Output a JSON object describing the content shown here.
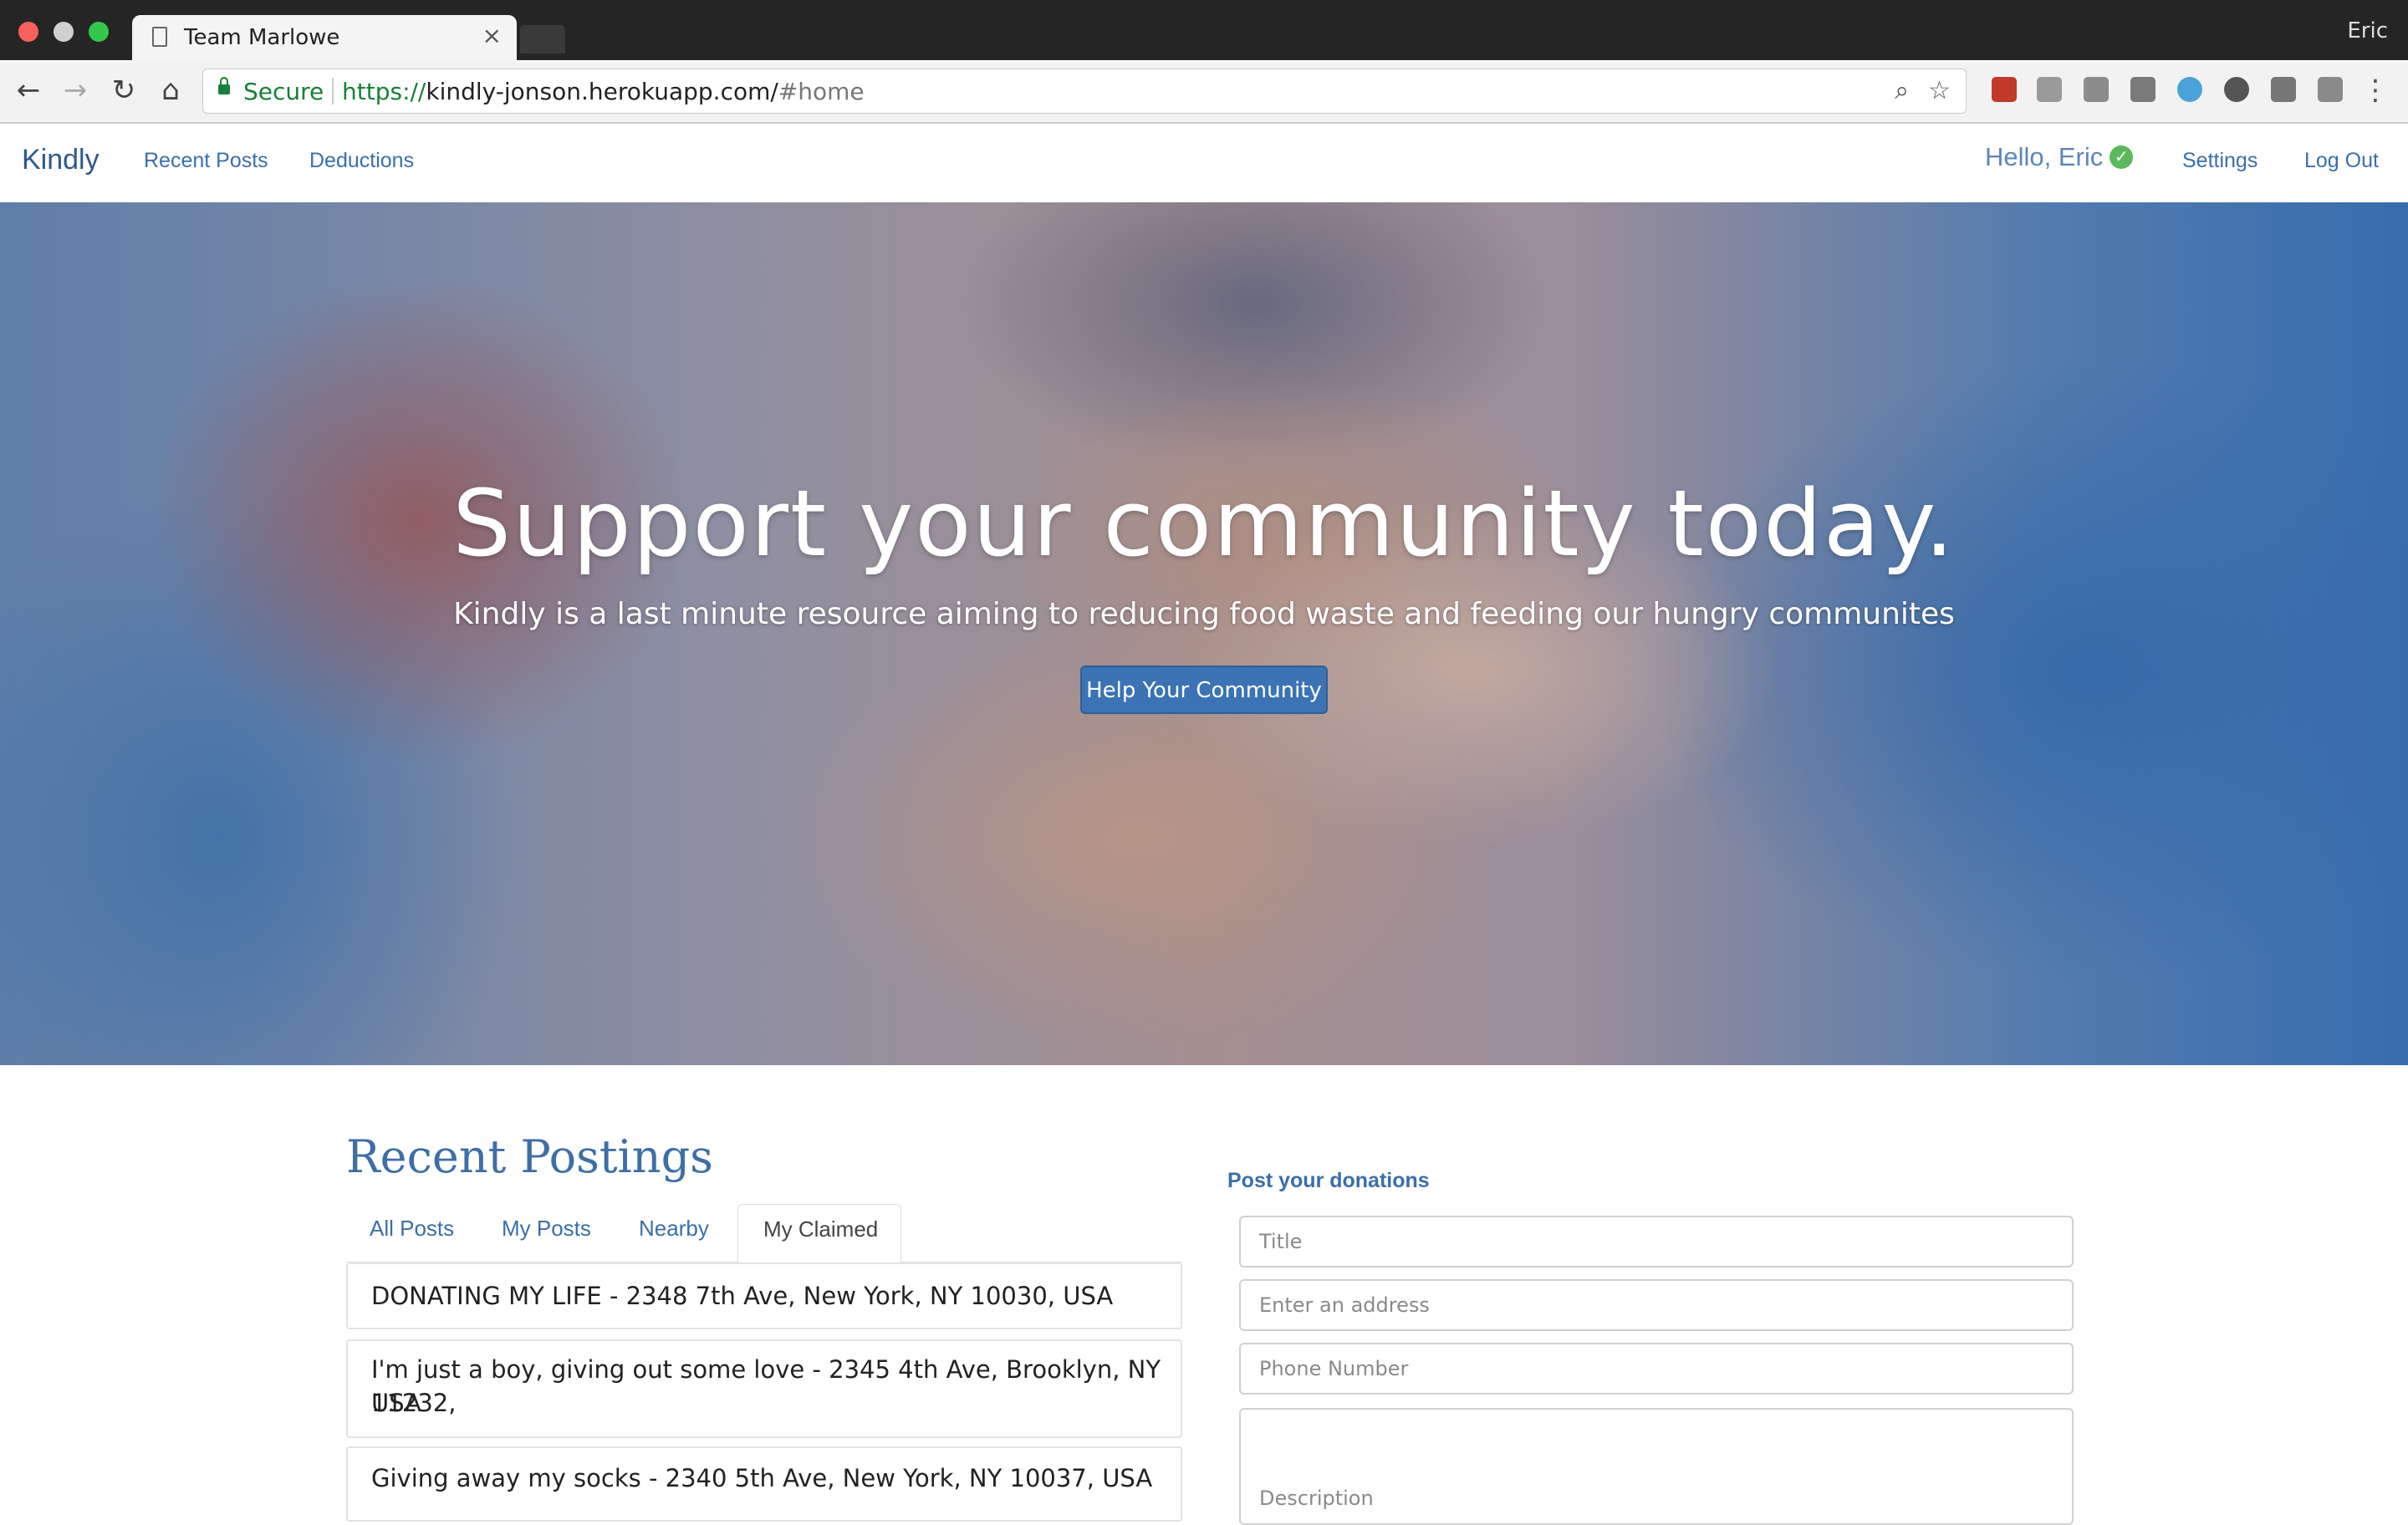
{
  "browser": {
    "tab_title": "Team Marlowe",
    "tab_close": "×",
    "profile_name": "Eric",
    "secure_label": "Secure",
    "url_protocol": "https://",
    "url_host": "kindly-jonson.herokuapp.com/",
    "url_fragment": "#home"
  },
  "navbar": {
    "brand": "Kindly",
    "links": [
      "Recent Posts",
      "Deductions"
    ],
    "greeting": "Hello, Eric",
    "settings": "Settings",
    "logout": "Log Out"
  },
  "hero": {
    "title": "Support your community today.",
    "subtitle": "Kindly is a last minute resource aiming to reducing food waste and feeding our hungry communites",
    "button": "Help Your Community"
  },
  "postings": {
    "title": "Recent Postings",
    "tabs": [
      "All Posts",
      "My Posts",
      "Nearby",
      "My Claimed"
    ],
    "active_tab": "My Claimed",
    "items": [
      "DONATING MY LIFE - 2348 7th Ave, New York, NY 10030, USA",
      "I'm just a boy, giving out some love - 2345 4th Ave, Brooklyn, NY 11232,",
      "USA",
      "Giving away my socks - 2340 5th Ave, New York, NY 10037, USA"
    ]
  },
  "donation_form": {
    "title": "Post your donations",
    "title_placeholder": "Title",
    "address_placeholder": "Enter an address",
    "phone_placeholder": "Phone Number",
    "description_placeholder": "Description"
  }
}
